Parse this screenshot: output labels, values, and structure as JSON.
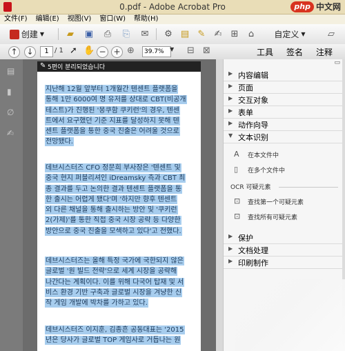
{
  "window": {
    "title": "0.pdf - Adobe Acrobat Pro"
  },
  "watermark": {
    "logo": "php",
    "text": "中文网"
  },
  "menu": [
    "文件(F)",
    "编辑(E)",
    "视图(V)",
    "窗口(W)",
    "帮助(H)"
  ],
  "toolbar": {
    "create_label": "创建",
    "custom_label": "自定义"
  },
  "nav": {
    "current_page": "1",
    "total_pages": "/ 1",
    "zoom": "39.7%"
  },
  "right_tabs": [
    "工具",
    "签名",
    "注释"
  ],
  "page_header": "5편이 분리되었습니다",
  "paragraphs": [
    [
      "지난해 12월 앞부터 1개월간 텐센트 플랫폼을",
      "통해 1만 6000여 명 유저를 상대로 CBT(비공개",
      "테스트)가 진행된 '몽쿠함 쿠키런'의 경우, 텐센",
      "트에서 요구했던 기준 지표를 달성하지 못해 텐",
      "센트 플랫폼을 통한 중국 진출은 어려울 것으로",
      "전망됐다."
    ],
    [
      "데브시스터즈 CFO 정문희 부사장은 '텐센트 및",
      "중국 현지 퍼블리셔인 iDreamsky 측과 CBT 최",
      "종 결과를 두고 논의한 결과 텐센트 플랫폼을 통",
      "한 출시는 어렵게 됐다'며 '하지만 향후 텐센트",
      "외 다른 채널을 통해 출시하는 방안 및 '쿠키런",
      "2(가제)'를 통한 직접 중국 시장 공략 등 다양한",
      "방안으로 중국 진출을 모색하고 있다'고 전했다."
    ],
    [
      "데브시스터즈는 올해 특정 국가에 국한되지 않은",
      "글로벌 '원 빌드 전략'으로 세계 시장을 공략해",
      "나간다는 계획이다. 이를 위해 다국어 탑재 및 서",
      "비스 환경 기반 구축과 글로벌 시장을 겨냥한 신",
      "작 게임 개발에 박차를 가하고 있다."
    ],
    [
      "데브시스터즈 이지훈, 김종흔 공동대표는 '2015",
      "년은 당사가 글로벌 TOP 게임사로 거듭나는 원"
    ]
  ],
  "panel": {
    "sections_top": [
      "内容编辑",
      "页面",
      "交互对象",
      "表单",
      "动作向导"
    ],
    "text_recognition": {
      "title": "文本识别",
      "items": [
        "在本文件中",
        "在多个文件中"
      ],
      "ocr_group": "OCR 可疑元素",
      "ocr_items": [
        "查找第一个可疑元素",
        "查找所有可疑元素"
      ]
    },
    "sections_bottom": [
      "保护",
      "文档处理",
      "印刷制作"
    ]
  }
}
